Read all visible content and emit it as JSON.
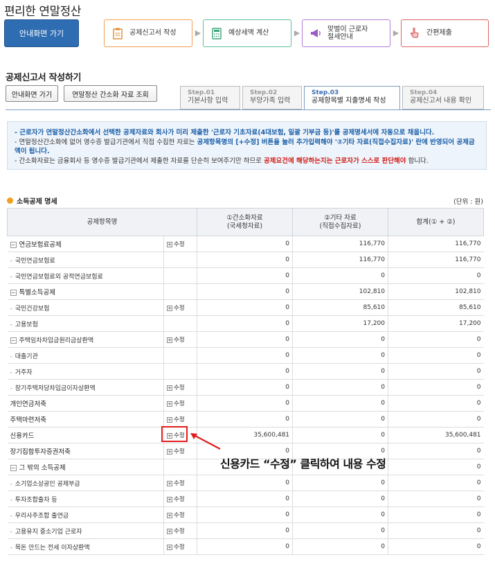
{
  "app": {
    "title": "편리한 연말정산"
  },
  "home_button": "안내화면 가기",
  "steps": [
    {
      "label": "공제신고서 작성",
      "icon": "document-icon",
      "color": "#f0a050"
    },
    {
      "label": "예상세액 계산",
      "icon": "calculator-icon",
      "color": "#5cc39a"
    },
    {
      "label": "맞벌이 근로자\n절세안내",
      "icon": "megaphone-icon",
      "color": "#b27cd6"
    },
    {
      "label": "간편제출",
      "icon": "click-hand-icon",
      "color": "#e06060"
    }
  ],
  "section_title": "공제신고서 작성하기",
  "sub_buttons": {
    "home": "안내화면 가기",
    "view": "연말정산 간소화 자료 조회"
  },
  "tabs": [
    {
      "num": "Step.01",
      "label": "기본사항 입력"
    },
    {
      "num": "Step.02",
      "label": "부양가족 입력"
    },
    {
      "num": "Step.03",
      "label": "공제항목별 지출명세 작성"
    },
    {
      "num": "Step.04",
      "label": "공제신고서 내용 확인"
    }
  ],
  "notice": {
    "line1": "- 근로자가 연말정산간소화에서 선택한 공제자료와 회사가 미리 제출한 '근로자 기초자료(4대보험, 일괄 기부금 등)'를 공제명세서에 자동으로 채웁니다.",
    "line2a": "- 연말정산간소화에 없어 영수증 발급기관에서 직접 수집한 자료는 ",
    "line2b": "공제항목명의 [+수정] 버튼을 눌러 추가입력해야 '②기타 자료(직접수집자료)' 란에 반영되어 공제금액이 됩니다.",
    "line3a": "- 간소화자료는 금융회사 등 영수증 발급기관에서 제출한 자료를 단순히 보여주기만 하므로 ",
    "line3b": "공제요건에 해당하는지는 근로자가 스스로 판단해야",
    "line3c": " 합니다."
  },
  "list_title": "소득공제 명세",
  "unit": "(단위 : 원)",
  "columns": {
    "item": "공제항목명",
    "simple": "①간소화자료\n(국세청자료)",
    "other": "②기타 자료\n(직접수집자료)",
    "total": "합계(① + ②)"
  },
  "edit_label": "수정",
  "rows": [
    {
      "name": "연금보험료공제",
      "level": 0,
      "toggle": true,
      "edit": true,
      "simple": "0",
      "other": "116,770",
      "total": "116,770"
    },
    {
      "name": "국민연금보험료",
      "level": 1,
      "toggle": false,
      "edit": false,
      "simple": "0",
      "other": "116,770",
      "total": "116,770"
    },
    {
      "name": "국민연금보험료외 공적연금보험료",
      "level": 1,
      "toggle": false,
      "edit": false,
      "simple": "0",
      "other": "0",
      "total": "0"
    },
    {
      "name": "특별소득공제",
      "level": 0,
      "toggle": true,
      "edit": false,
      "simple": "0",
      "other": "102,810",
      "total": "102,810"
    },
    {
      "name": "국민건강보험",
      "level": 1,
      "toggle": false,
      "edit": true,
      "simple": "0",
      "other": "85,610",
      "total": "85,610"
    },
    {
      "name": "고용보험",
      "level": 1,
      "toggle": false,
      "edit": false,
      "simple": "0",
      "other": "17,200",
      "total": "17,200"
    },
    {
      "name": "주택임차차입금원리금상환액",
      "level": 1,
      "toggle": true,
      "edit": true,
      "simple": "0",
      "other": "0",
      "total": "0"
    },
    {
      "name": "대출기관",
      "level": 2,
      "toggle": false,
      "edit": false,
      "simple": "0",
      "other": "0",
      "total": "0"
    },
    {
      "name": "거주자",
      "level": 2,
      "toggle": false,
      "edit": false,
      "simple": "0",
      "other": "0",
      "total": "0"
    },
    {
      "name": "장기주택저당차입금이자상환액",
      "level": 1,
      "toggle": false,
      "edit": true,
      "simple": "0",
      "other": "0",
      "total": "0"
    },
    {
      "name": "개인연금저축",
      "level": 0,
      "toggle": false,
      "edit": true,
      "simple": "0",
      "other": "0",
      "total": "0"
    },
    {
      "name": "주택마련저축",
      "level": 0,
      "toggle": false,
      "edit": true,
      "simple": "0",
      "other": "0",
      "total": "0"
    },
    {
      "name": "신용카드",
      "level": 0,
      "toggle": false,
      "edit": true,
      "simple": "35,600,481",
      "other": "0",
      "total": "35,600,481"
    },
    {
      "name": "장기집합투자증권저축",
      "level": 0,
      "toggle": false,
      "edit": true,
      "simple": "0",
      "other": "0",
      "total": "0"
    },
    {
      "name": "그 밖의 소득공제",
      "level": 0,
      "toggle": true,
      "edit": false,
      "simple": "0",
      "other": "0",
      "total": "0"
    },
    {
      "name": "소기업소상공인 공제부금",
      "level": 1,
      "toggle": false,
      "edit": true,
      "simple": "0",
      "other": "0",
      "total": "0"
    },
    {
      "name": "투자조합출자 등",
      "level": 1,
      "toggle": false,
      "edit": true,
      "simple": "0",
      "other": "0",
      "total": "0"
    },
    {
      "name": "우리사주조합 출연금",
      "level": 1,
      "toggle": false,
      "edit": true,
      "simple": "0",
      "other": "0",
      "total": "0"
    },
    {
      "name": "고용유지 중소기업 근로자",
      "level": 1,
      "toggle": false,
      "edit": true,
      "simple": "0",
      "other": "0",
      "total": "0"
    },
    {
      "name": "목돈 안드는 전세 이자상환액",
      "level": 1,
      "toggle": false,
      "edit": true,
      "simple": "0",
      "other": "0",
      "total": "0"
    }
  ],
  "annotation": "신용카드 “수정” 클릭하여 내용 수정",
  "colors": {
    "accent_blue": "#2f6db3",
    "highlight_red": "#e21c1c"
  }
}
